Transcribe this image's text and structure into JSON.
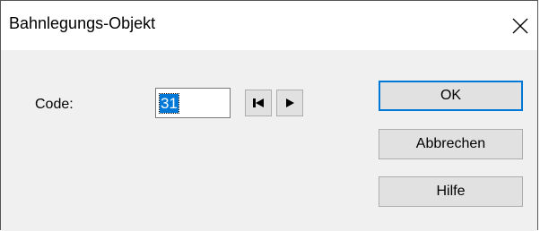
{
  "window": {
    "title": "Bahnlegungs-Objekt"
  },
  "form": {
    "code_label": "Code:",
    "code_value": "31"
  },
  "navigation": {
    "first_icon": "skip-to-first-icon",
    "next_icon": "play-next-icon"
  },
  "buttons": {
    "ok": "OK",
    "cancel": "Abbrechen",
    "help": "Hilfe"
  },
  "colors": {
    "accent": "#0078d7",
    "button_face": "#e1e1e1",
    "dialog_background": "#f0f0f0"
  }
}
